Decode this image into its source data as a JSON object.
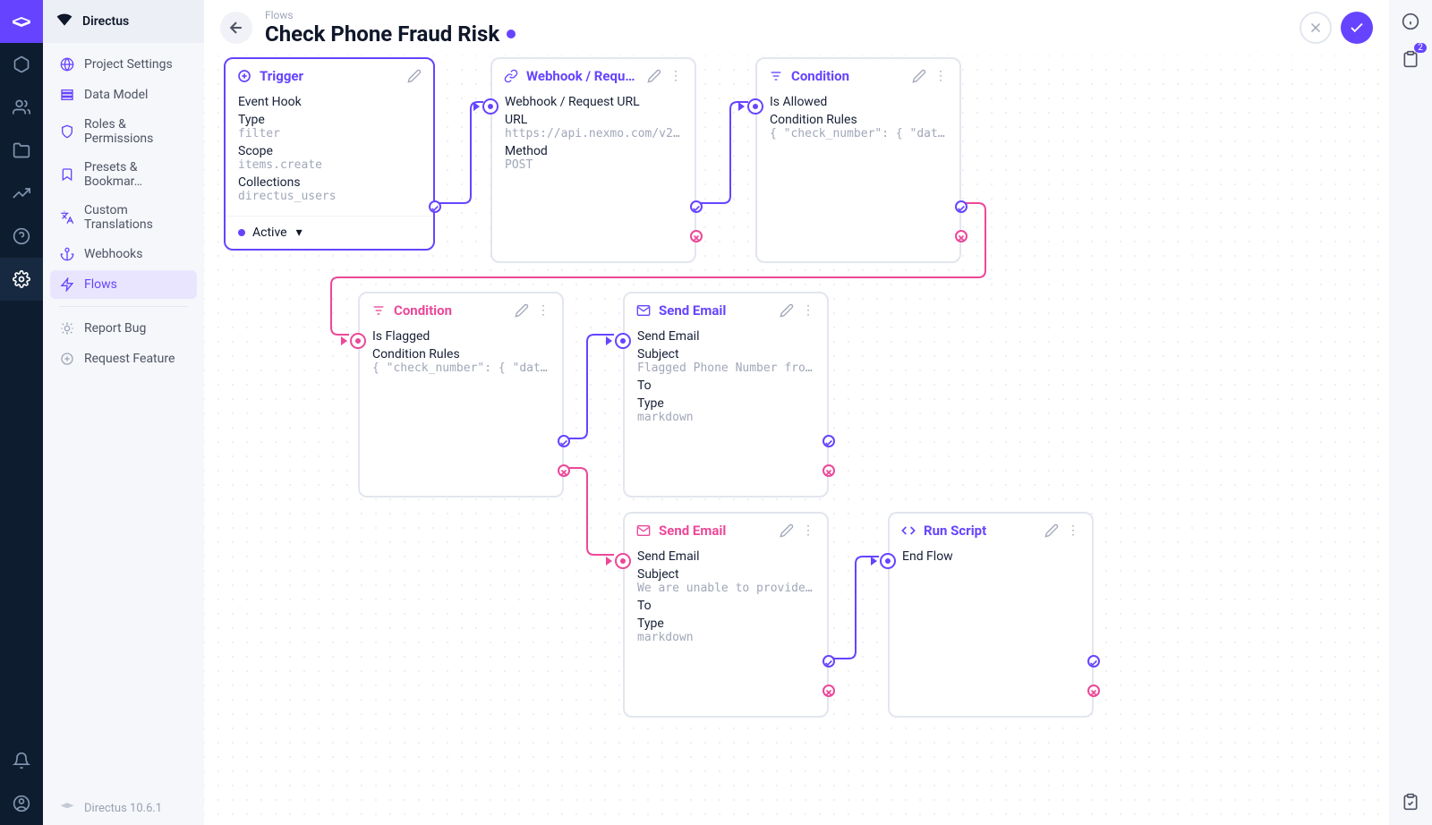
{
  "brand": "Directus",
  "breadcrumb": "Flows",
  "page_title": "Check Phone Fraud Risk",
  "version": "Directus 10.6.1",
  "revisions_badge": "2",
  "nav": {
    "items": [
      {
        "label": "Project Settings"
      },
      {
        "label": "Data Model"
      },
      {
        "label": "Roles & Permissions"
      },
      {
        "label": "Presets & Bookmar…"
      },
      {
        "label": "Custom Translations"
      },
      {
        "label": "Webhooks"
      },
      {
        "label": "Flows"
      }
    ],
    "footer": [
      {
        "label": "Report Bug"
      },
      {
        "label": "Request Feature"
      }
    ]
  },
  "nodes": {
    "trigger": {
      "title": "Trigger",
      "sub": "Event Hook",
      "fields": [
        {
          "label": "Type",
          "value": "filter"
        },
        {
          "label": "Scope",
          "value": "items.create"
        },
        {
          "label": "Collections",
          "value": "directus_users"
        }
      ],
      "status": "Active"
    },
    "webhook": {
      "title": "Webhook / Request U",
      "sub": "Webhook / Request URL",
      "fields": [
        {
          "label": "URL",
          "value": "https://api.nexmo.com/v2/ni"
        },
        {
          "label": "Method",
          "value": "POST"
        }
      ]
    },
    "cond1": {
      "title": "Condition",
      "sub": "Is Allowed",
      "fields": [
        {
          "label": "Condition Rules",
          "value": "{ \"check_number\": { \"data\"…"
        }
      ]
    },
    "cond2": {
      "title": "Condition",
      "sub": "Is Flagged",
      "fields": [
        {
          "label": "Condition Rules",
          "value": "{ \"check_number\": { \"data\"…"
        }
      ]
    },
    "email1": {
      "title": "Send Email",
      "sub": "Send Email",
      "fields": [
        {
          "label": "Subject",
          "value": "Flagged Phone Number from …"
        },
        {
          "label": "To",
          "value": ""
        },
        {
          "label": "Type",
          "value": "markdown"
        }
      ]
    },
    "email2": {
      "title": "Send Email",
      "sub": "Send Email",
      "fields": [
        {
          "label": "Subject",
          "value": "We are unable to provide a…"
        },
        {
          "label": "To",
          "value": ""
        },
        {
          "label": "Type",
          "value": "markdown"
        }
      ]
    },
    "script": {
      "title": "Run Script",
      "sub": "End Flow"
    }
  }
}
